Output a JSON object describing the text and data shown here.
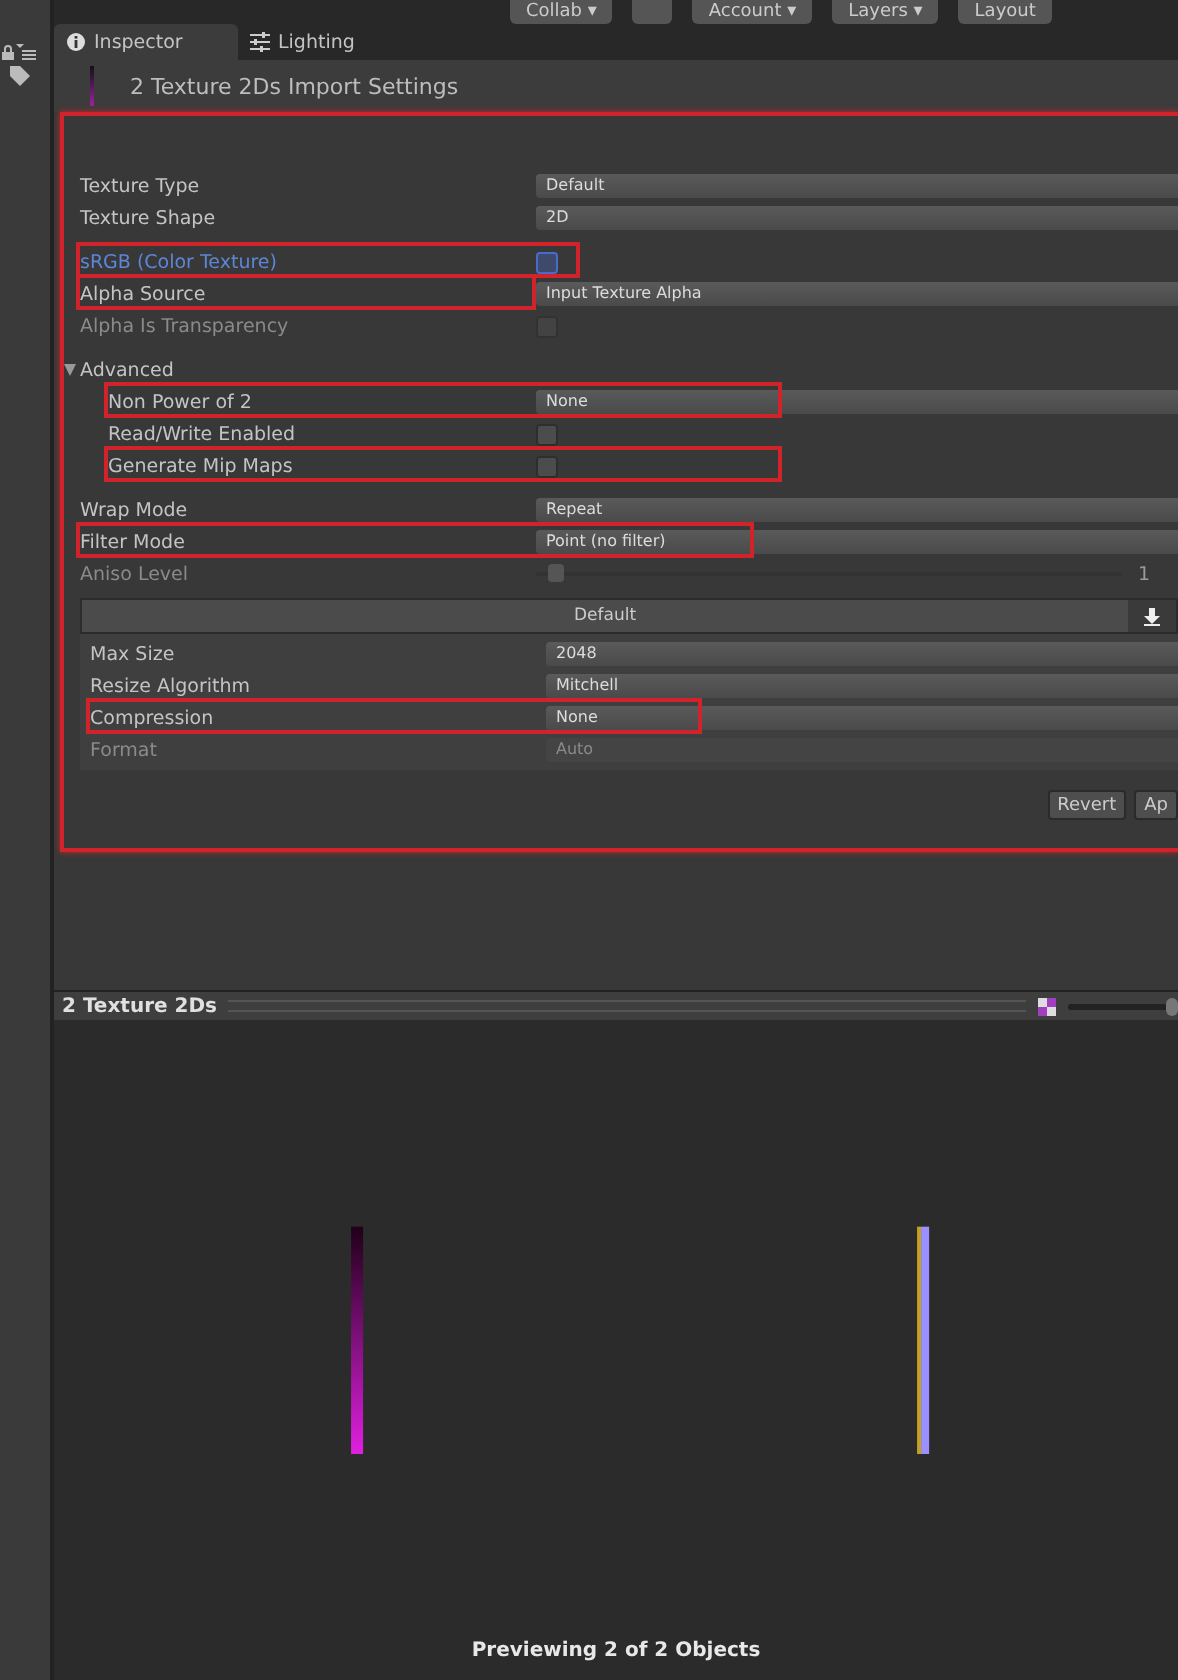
{
  "toolbar": {
    "buttons": [
      {
        "label": "Collab ▾"
      },
      {
        "label": "Account ▾"
      },
      {
        "label": "Layers ▾"
      },
      {
        "label": "Layout"
      }
    ]
  },
  "tabs": [
    {
      "label": "Inspector",
      "selected": true,
      "kind": "info"
    },
    {
      "label": "Lighting",
      "selected": false,
      "kind": "sliders"
    }
  ],
  "header": {
    "title": "2 Texture 2Ds Import Settings"
  },
  "settings": {
    "highlighted": true,
    "rows": [
      {
        "kind": "dropdown",
        "label": "Texture Type",
        "value": "Default"
      },
      {
        "kind": "dropdown",
        "label": "Texture Shape",
        "value": "2D"
      },
      {
        "kind": "gap"
      },
      {
        "kind": "checkbox",
        "label": "sRGB (Color Texture)",
        "checked": false,
        "focused": true,
        "highlighted": true
      },
      {
        "kind": "dropdown",
        "label": "Alpha Source",
        "value": "Input Texture Alpha",
        "highlighted": true
      },
      {
        "kind": "checkbox",
        "label": "Alpha Is Transparency",
        "checked": false,
        "disabled": true
      },
      {
        "kind": "gap"
      },
      {
        "kind": "foldout",
        "label": "Advanced",
        "expanded": true,
        "children": [
          {
            "kind": "dropdown",
            "label": "Non Power of 2",
            "value": "None",
            "highlighted": true
          },
          {
            "kind": "checkbox",
            "label": "Read/Write Enabled",
            "checked": false
          },
          {
            "kind": "checkbox",
            "label": "Generate Mip Maps",
            "checked": false,
            "highlighted": true
          }
        ]
      },
      {
        "kind": "gap"
      },
      {
        "kind": "dropdown",
        "label": "Wrap Mode",
        "value": "Repeat"
      },
      {
        "kind": "dropdown",
        "label": "Filter Mode",
        "value": "Point (no filter)",
        "highlighted": true
      },
      {
        "kind": "slider",
        "label": "Aniso Level",
        "level": 0.02,
        "reading": "1",
        "disabled": true
      }
    ]
  },
  "platform": {
    "tab": "Default",
    "rows": [
      {
        "label": "Max Size",
        "value": "2048"
      },
      {
        "label": "Resize Algorithm",
        "value": "Mitchell"
      },
      {
        "label": "Compression",
        "value": "None",
        "highlighted": true
      },
      {
        "label": "Format",
        "value": "Auto",
        "disabled": true
      }
    ]
  },
  "buttons": [
    {
      "label": "Revert"
    },
    {
      "label": "Ap"
    }
  ],
  "preview": {
    "title": "2 Texture 2Ds",
    "zoom": {
      "level": 1
    },
    "footer": "Previewing 2 of 2 Objects"
  }
}
